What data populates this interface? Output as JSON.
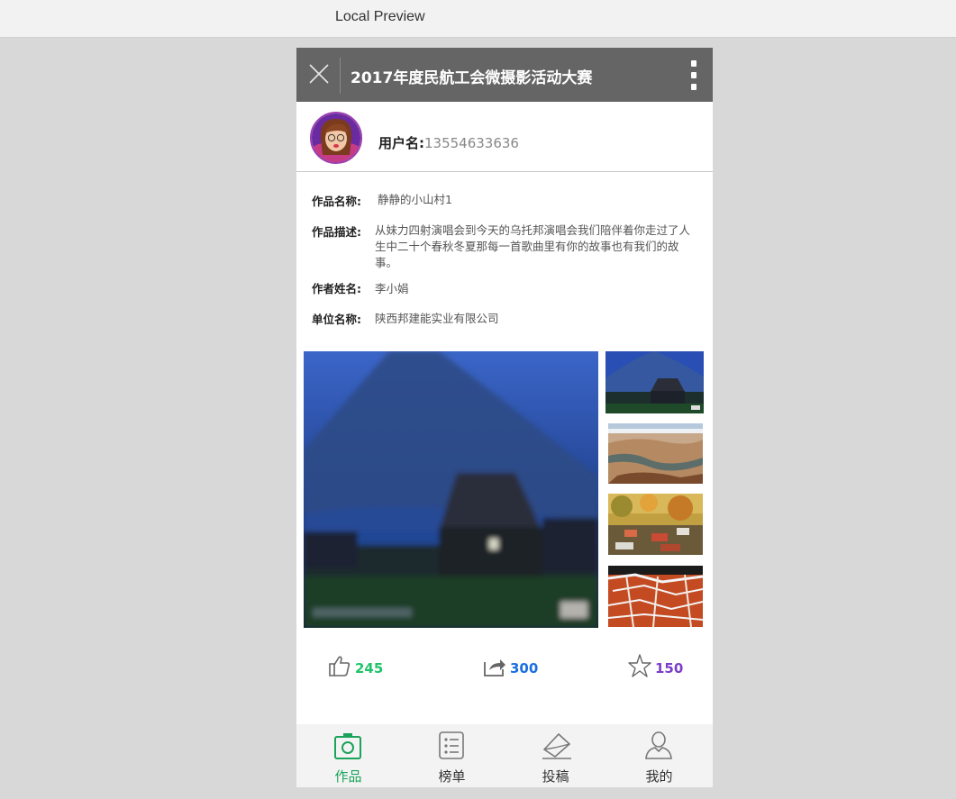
{
  "browser": {
    "title": "Local Preview"
  },
  "header": {
    "title": "2017年度民航工会微摄影活动大赛"
  },
  "user": {
    "label": "用户名:",
    "value": "13554633636"
  },
  "work": {
    "name_label": "作品名称:",
    "name_value": "静静的小山村1",
    "desc_label": "作品描述:",
    "desc_value": "从妹力四射演唱会到今天的乌托邦演唱会我们陪伴着你走过了人生中二十个春秋冬夏那每一首歌曲里有你的故事也有我们的故事。",
    "author_label": "作者姓名:",
    "author_value": "李小娟",
    "unit_label": "单位名称:",
    "unit_value": "陕西邦建能实业有限公司"
  },
  "stats": {
    "likes": "245",
    "shares": "300",
    "favorites": "150"
  },
  "colors": {
    "likes": "#1fc46a",
    "shares": "#1a6fe0",
    "favorites": "#7a3fc9",
    "active_tab": "#1aa35a",
    "header_bg": "#656565"
  },
  "tabs": [
    {
      "label": "作品",
      "icon": "camera-icon",
      "active": true
    },
    {
      "label": "榜单",
      "icon": "list-icon",
      "active": false
    },
    {
      "label": "投稿",
      "icon": "submit-icon",
      "active": false
    },
    {
      "label": "我的",
      "icon": "user-icon",
      "active": false
    }
  ]
}
